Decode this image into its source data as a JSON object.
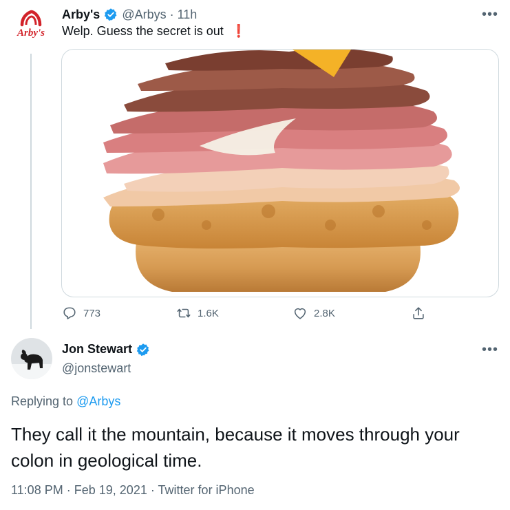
{
  "original_tweet": {
    "display_name": "Arby's",
    "handle": "@Arbys",
    "separator": "·",
    "time": "11h",
    "text": "Welp. Guess the secret is out",
    "avatar_logo_text": "Arby's",
    "stats": {
      "replies": "773",
      "retweets": "1.6K",
      "likes": "2.8K"
    }
  },
  "reply_tweet": {
    "display_name": "Jon Stewart",
    "handle": "@jonstewart",
    "replying_prefix": "Replying to",
    "replying_handle": "@Arbys",
    "text": "They call it the mountain, because it moves through your colon in geological time.",
    "time": "11:08 PM",
    "date": "Feb 19, 2021",
    "source": "Twitter for iPhone",
    "separator": "·"
  },
  "colors": {
    "verified": "#1d9bf0",
    "arbys_red": "#d2232a",
    "muted": "#536471",
    "link": "#1d9bf0"
  }
}
